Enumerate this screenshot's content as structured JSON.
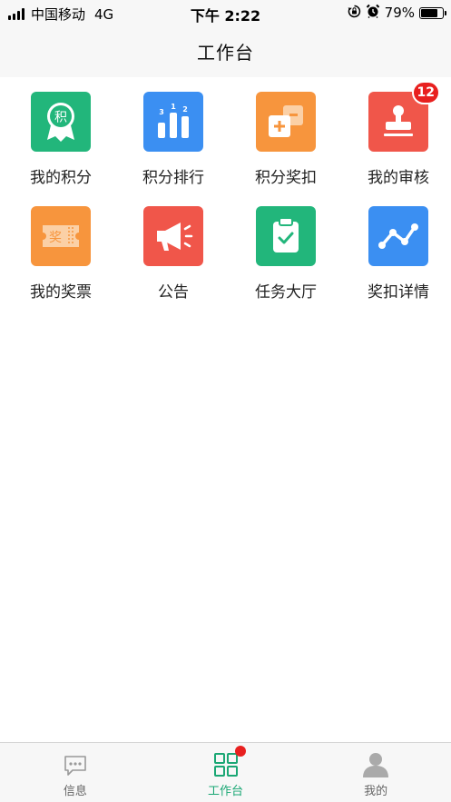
{
  "status_bar": {
    "carrier": "中国移动",
    "network": "4G",
    "time": "下午 2:22",
    "battery_percent": "79%",
    "battery_level": 0.79,
    "icons": [
      "signal-icon",
      "rotation-lock-icon",
      "alarm-icon",
      "battery-icon"
    ]
  },
  "nav": {
    "title": "工作台"
  },
  "grid": {
    "items": [
      {
        "label": "我的积分",
        "icon": "points-badge-icon",
        "color": "#22b67b",
        "glyph": "积"
      },
      {
        "label": "积分排行",
        "icon": "ranking-podium-icon",
        "color": "#3b8ff2",
        "glyph": "3 1 2"
      },
      {
        "label": "积分奖扣",
        "icon": "plus-minus-cards-icon",
        "color": "#f7953d"
      },
      {
        "label": "我的审核",
        "icon": "stamp-icon",
        "color": "#f0564a",
        "badge": "12"
      },
      {
        "label": "我的奖票",
        "icon": "ticket-icon",
        "color": "#f7953d",
        "glyph": "奖"
      },
      {
        "label": "公告",
        "icon": "megaphone-icon",
        "color": "#f0564a"
      },
      {
        "label": "任务大厅",
        "icon": "clipboard-check-icon",
        "color": "#22b67b"
      },
      {
        "label": "奖扣详情",
        "icon": "line-trend-icon",
        "color": "#3b8ff2"
      }
    ]
  },
  "tab_bar": {
    "tabs": [
      {
        "label": "信息",
        "icon": "message-bubble-icon",
        "active": false
      },
      {
        "label": "工作台",
        "icon": "grid-squares-icon",
        "active": true,
        "dot": true
      },
      {
        "label": "我的",
        "icon": "user-avatar-icon",
        "active": false
      }
    ],
    "active_color": "#1aa774"
  }
}
